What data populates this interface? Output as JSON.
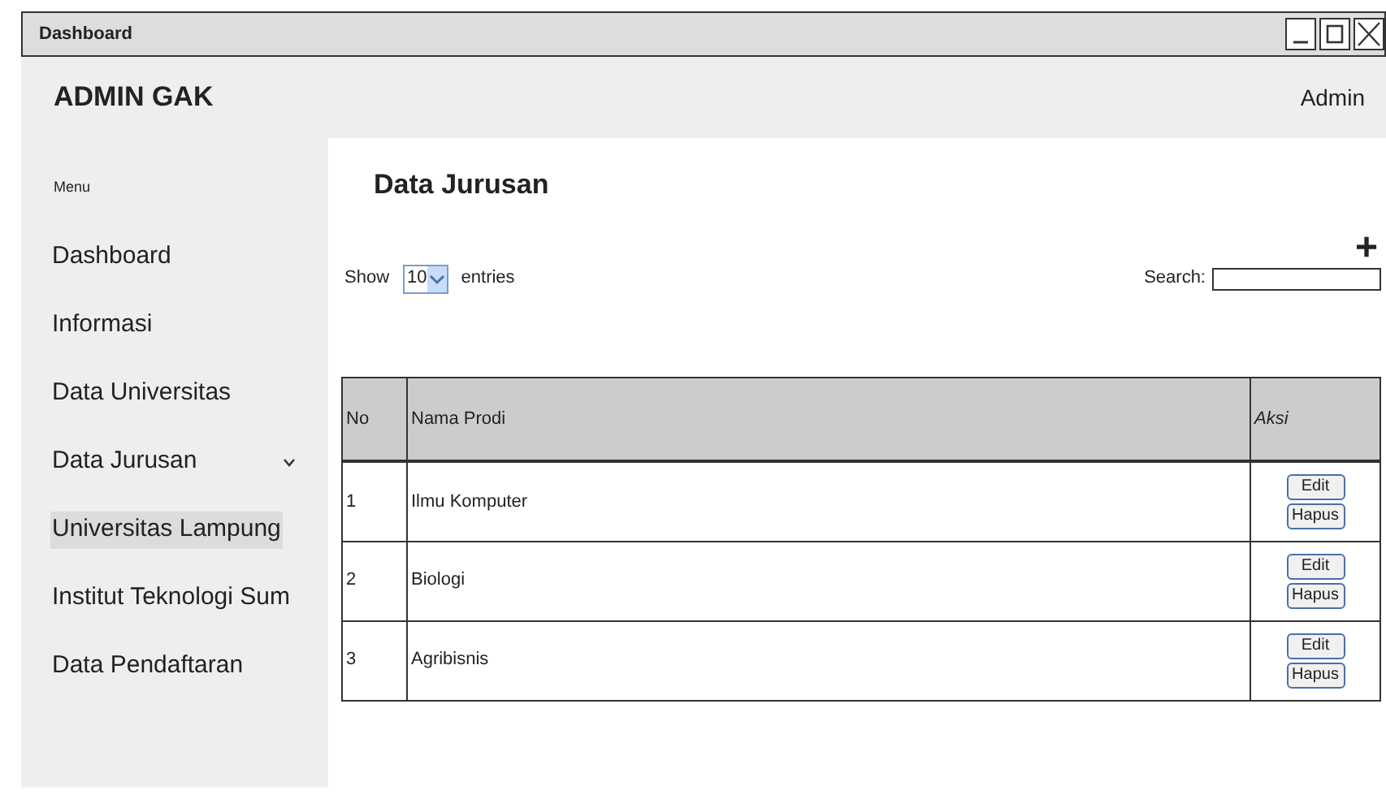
{
  "window": {
    "title": "Dashboard"
  },
  "header": {
    "brand": "ADMIN GAK",
    "user": "Admin"
  },
  "sidebar": {
    "heading": "Menu",
    "items": [
      {
        "label": "Dashboard",
        "selected": false
      },
      {
        "label": "Informasi",
        "selected": false
      },
      {
        "label": "Data Universitas",
        "selected": false
      },
      {
        "label": "Data Jurusan",
        "selected": false,
        "expanded": true,
        "children": [
          {
            "label": "Universitas Lampung",
            "selected": true
          },
          {
            "label": "Institut Teknologi Sum",
            "selected": false
          }
        ]
      },
      {
        "label": "Data Pendaftaran",
        "selected": false
      }
    ]
  },
  "page": {
    "title": "Data Jurusan",
    "add": "+",
    "show_label": "Show",
    "entries_value": "10",
    "entries_label": "entries",
    "search_label": "Search:"
  },
  "table": {
    "columns": [
      "No",
      "Nama Prodi",
      "Aksi"
    ],
    "rows": [
      {
        "no": "1",
        "name": "Ilmu Komputer",
        "actions": [
          "Edit",
          "Hapus"
        ]
      },
      {
        "no": "2",
        "name": "Biologi",
        "actions": [
          "Edit",
          "Hapus"
        ]
      },
      {
        "no": "3",
        "name": "Agribisnis",
        "actions": [
          "Edit",
          "Hapus"
        ]
      }
    ]
  }
}
